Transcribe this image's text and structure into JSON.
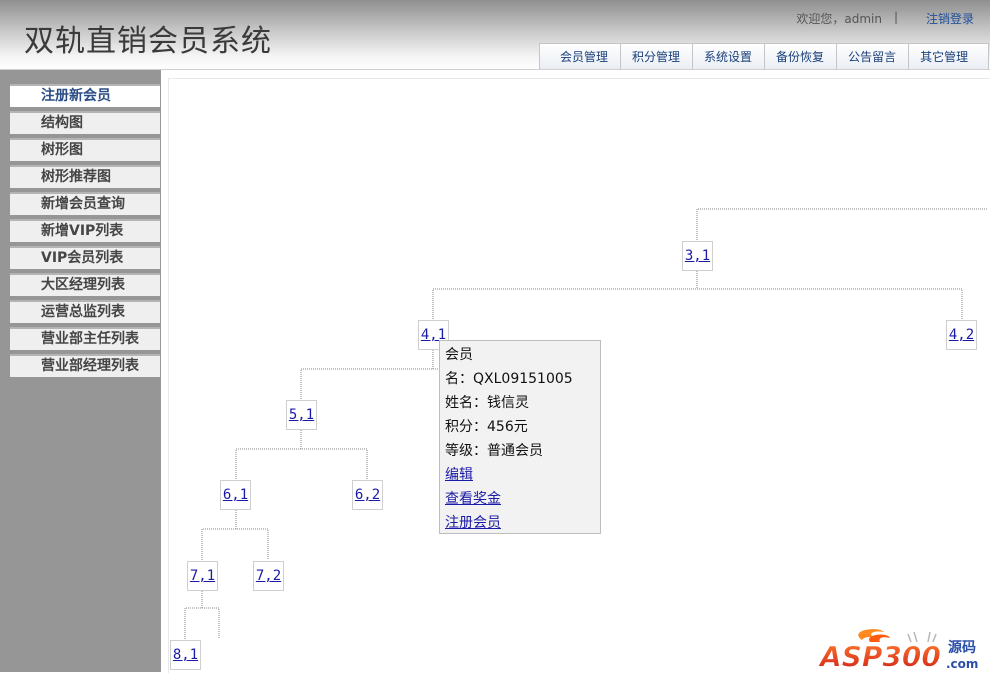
{
  "header": {
    "title": "双轨直销会员系统",
    "welcome": "欢迎您，admin",
    "separator": "|",
    "logout_label": "注销登录",
    "tabs": [
      "会员管理",
      "积分管理",
      "系统设置",
      "备份恢复",
      "公告留言",
      "其它管理"
    ]
  },
  "sidebar": {
    "items": [
      "注册新会员",
      "结构图",
      "树形图",
      "树形推荐图",
      "新增会员查询",
      "新增VIP列表",
      "VIP会员列表",
      "大区经理列表",
      "运营总监列表",
      "营业部主任列表",
      "营业部经理列表"
    ],
    "active_index": 0
  },
  "tree": {
    "nodes": [
      "3,1",
      "4,1",
      "4,2",
      "5,1",
      "6,1",
      "6,2",
      "7,1",
      "7,2",
      "8,1"
    ]
  },
  "tooltip": {
    "line1": "会员",
    "line2": "名：QXL09151005",
    "line3": "姓名：钱信灵",
    "line4": "积分：456元",
    "line5": "等级：普通会员",
    "edit_link": "编辑",
    "bonus_link": "查看奖金",
    "register_link": "注册会员"
  },
  "watermark": {
    "text": "ASP300",
    "suffix": "源码",
    "domain": ".com"
  },
  "colors": {
    "link": "#1a1aa6",
    "nav_text": "#1a3f7a",
    "sidebar_bg": "#969696"
  }
}
